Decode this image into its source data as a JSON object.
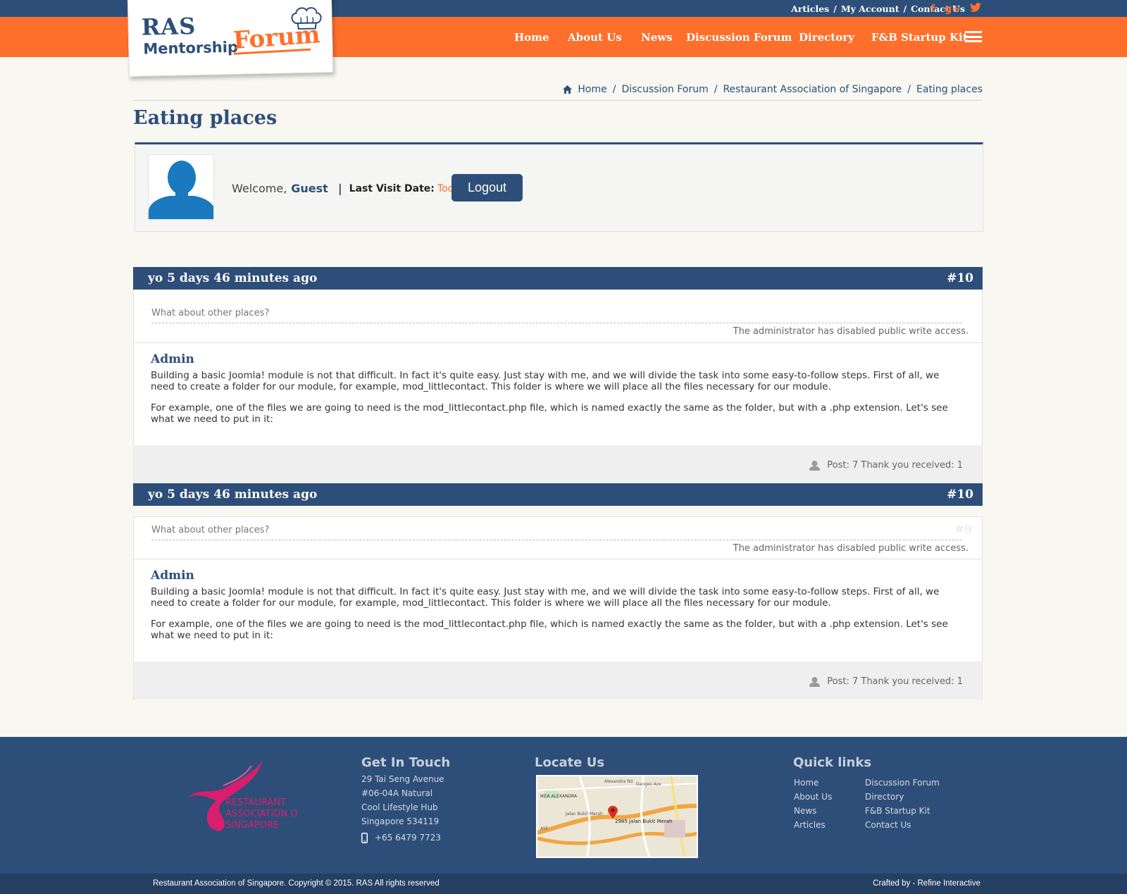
{
  "top_links": [
    "Articles",
    "/",
    "My Account",
    "/",
    "Contact Us"
  ],
  "social": {
    "facebook": "f",
    "gplus": "g+",
    "twitter": "twitter-icon"
  },
  "nav": [
    "Home",
    "About Us",
    "News",
    "Discussion Forum",
    "Directory",
    "F&B Startup Kit"
  ],
  "logo": {
    "line1": "RAS",
    "line2": "Mentorship",
    "line3": "Forum"
  },
  "breadcrumb": [
    "Home",
    "Discussion Forum",
    "Restaurant Association of Singapore",
    "Eating places"
  ],
  "page_title": "Eating places",
  "user": {
    "welcome": "Welcome,",
    "name": "Guest",
    "pipe": "|",
    "last_visit_label": "Last Visit Date:",
    "last_visit_value": "Today",
    "logout": "Logout"
  },
  "posts": [
    {
      "header": "yo 5 days 46 minutes ago",
      "number": "#10",
      "quote": "What about other places?",
      "ghost_number": "",
      "notice": "The administrator has disabled public write access.",
      "author": "Admin",
      "paragraphs": [
        "Building a basic Joomla! module is not that difficult. In fact it's quite easy. Just stay with me, and we will divide the task into some easy-to-follow steps. First of all, we need to create a folder for our module, for example, mod_littlecontact. This folder is where we will place all the files necessary for our module.",
        "For example, one of the files we are going to need is the mod_littlecontact.php file, which is named exactly the same as the folder, but with a .php extension. Let's see what we need to put in it:"
      ],
      "stats": "Post: 7 Thank you received: 1"
    },
    {
      "header": "yo 5 days 46 minutes ago",
      "number": "#10",
      "quote": "What about other places?",
      "ghost_number": "#9",
      "notice": "The administrator has disabled public write access.",
      "author": "Admin",
      "paragraphs": [
        "Building a basic Joomla! module is not that difficult. In fact it's quite easy. Just stay with me, and we will divide the task into some easy-to-follow steps. First of all, we need to create a folder for our module, for example, mod_littlecontact. This folder is where we will place all the files necessary for our module.",
        "For example, one of the files we are going to need is the mod_littlecontact.php file, which is named exactly the same as the folder, but with a .php extension. Let's see what we need to put in it:"
      ],
      "stats": "Post: 7 Thank you received: 1"
    }
  ],
  "footer": {
    "ras_logo": [
      "RESTAURANT",
      "ASSOCIATION OF",
      "SINGAPORE"
    ],
    "get_in_touch": {
      "title": "Get In Touch",
      "lines": [
        "29 Tai Seng Avenue",
        "#06-04A Natural",
        "Cool Lifestyle Hub",
        "Singapore 534119"
      ],
      "phone": "+65 6479 7723"
    },
    "locate_us": {
      "title": "Locate Us",
      "map_label": "2985 Jalan Bukit Merah",
      "map_streets": [
        "Alexandra Rd",
        "Ganges Ave",
        "IKEA ALEXANDRA",
        "Jalan Bukit Merah",
        "AYE"
      ]
    },
    "quick_links": {
      "title": "Quick links",
      "col1": [
        "Home",
        "About Us",
        "News",
        "Articles"
      ],
      "col2": [
        "Discussion Forum",
        "Directory",
        "F&B Startup Kit",
        "Contact Us"
      ]
    },
    "copyright": "Restaurant Association of Singapore. Copyright © 2015. RAS All rights reserved",
    "crafted": "Crafted by - Refine Interactive"
  },
  "colors": {
    "navy": "#2d4e78",
    "orange": "#ff6f2c",
    "background": "#f8f7f2",
    "ras_pink": "#d91d6f"
  }
}
